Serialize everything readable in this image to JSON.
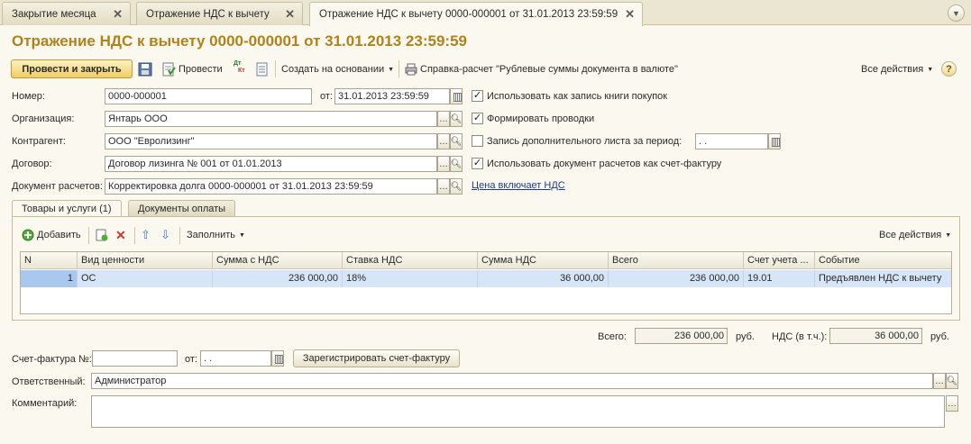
{
  "tabs": [
    {
      "label": "Закрытие месяца"
    },
    {
      "label": "Отражение НДС к вычету"
    },
    {
      "label": "Отражение НДС к вычету 0000-000001 от 31.01.2013 23:59:59"
    }
  ],
  "title": "Отражение НДС к вычету 0000-000001 от 31.01.2013 23:59:59",
  "toolbar": {
    "post_close": "Провести и закрыть",
    "post": "Провести",
    "create_based": "Создать на основании",
    "report": "Справка-расчет \"Рублевые суммы документа в валюте\"",
    "all_actions": "Все действия",
    "dt": "Дт",
    "kt": "Кт"
  },
  "form": {
    "number_label": "Номер:",
    "number": "0000-000001",
    "date_label": "от:",
    "date": "31.01.2013 23:59:59",
    "org_label": "Организация:",
    "org": "Янтарь ООО",
    "contractor_label": "Контрагент:",
    "contractor": "ООО \"Евролизинг\"",
    "contract_label": "Договор:",
    "contract": "Договор лизинга № 001 от 01.01.2013",
    "settlement_label": "Документ расчетов:",
    "settlement": "Корректировка долга 0000-000001 от 31.01.2013 23:59:59",
    "chk_purchase_book": "Использовать как запись книги покупок",
    "chk_postings": "Формировать проводки",
    "chk_extra_sheet": "Запись дополнительного листа за период:",
    "extra_period": " .  .",
    "chk_use_doc_invoice": "Использовать документ расчетов как счет-фактуру",
    "price_includes_vat": "Цена включает НДС"
  },
  "inner_tabs": [
    {
      "label": "Товары и услуги (1)"
    },
    {
      "label": "Документы оплаты"
    }
  ],
  "table_toolbar": {
    "add": "Добавить",
    "fill": "Заполнить",
    "all_actions": "Все действия"
  },
  "table": {
    "headers": [
      "N",
      "Вид ценности",
      "Сумма с НДС",
      "Ставка НДС",
      "Сумма НДС",
      "Всего",
      "Счет учета ...",
      "Событие"
    ],
    "rows": [
      [
        "1",
        "ОС",
        "236 000,00",
        "18%",
        "36 000,00",
        "236 000,00",
        "19.01",
        "Предъявлен НДС к вычету"
      ]
    ]
  },
  "totals": {
    "total_label": "Всего:",
    "total": "236 000,00",
    "currency": "руб.",
    "vat_label": "НДС (в т.ч.):",
    "vat": "36 000,00",
    "vat_currency": "руб."
  },
  "footer": {
    "invoice_label": "Счет-фактура №:",
    "invoice_no": "",
    "invoice_date_label": "от:",
    "invoice_date": " .  .",
    "register_btn": "Зарегистрировать счет-фактуру",
    "responsible_label": "Ответственный:",
    "responsible": "Администратор",
    "comment_label": "Комментарий:",
    "comment": ""
  },
  "colors": {
    "title": "#b1811c",
    "link": "#1c3d8f",
    "selection": "#d6e6f8"
  }
}
